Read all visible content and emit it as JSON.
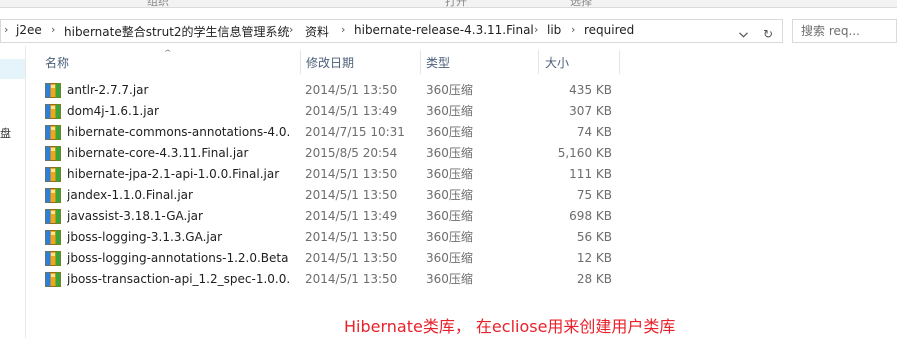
{
  "ribbon": {
    "groups": [
      "组织",
      "打开",
      "选择"
    ]
  },
  "address_bar": {
    "breadcrumbs": [
      "j2ee",
      "hibernate整合strut2的学生信息管理系统",
      "资料",
      "hibernate-release-4.3.11.Final",
      "lib",
      "required"
    ],
    "separator": "›",
    "refresh_glyph": "↻"
  },
  "search": {
    "placeholder": "搜索 req..."
  },
  "navigation_pane": {
    "partial_label": "盘"
  },
  "columns": {
    "name": "名称",
    "date_modified": "修改日期",
    "type": "类型",
    "size": "大小",
    "sort_indicator": "^"
  },
  "files": [
    {
      "name": "antlr-2.7.7.jar",
      "date": "2014/5/1 13:50",
      "type": "360压缩",
      "size": "435 KB"
    },
    {
      "name": "dom4j-1.6.1.jar",
      "date": "2014/5/1 13:49",
      "type": "360压缩",
      "size": "307 KB"
    },
    {
      "name": "hibernate-commons-annotations-4.0....",
      "date": "2014/7/15 10:31",
      "type": "360压缩",
      "size": "74 KB"
    },
    {
      "name": "hibernate-core-4.3.11.Final.jar",
      "date": "2015/8/5 20:54",
      "type": "360压缩",
      "size": "5,160 KB"
    },
    {
      "name": "hibernate-jpa-2.1-api-1.0.0.Final.jar",
      "date": "2014/5/1 13:50",
      "type": "360压缩",
      "size": "111 KB"
    },
    {
      "name": "jandex-1.1.0.Final.jar",
      "date": "2014/5/1 13:50",
      "type": "360压缩",
      "size": "75 KB"
    },
    {
      "name": "javassist-3.18.1-GA.jar",
      "date": "2014/5/1 13:49",
      "type": "360压缩",
      "size": "698 KB"
    },
    {
      "name": "jboss-logging-3.1.3.GA.jar",
      "date": "2014/5/1 13:50",
      "type": "360压缩",
      "size": "56 KB"
    },
    {
      "name": "jboss-logging-annotations-1.2.0.Beta...",
      "date": "2014/5/1 13:50",
      "type": "360压缩",
      "size": "12 KB"
    },
    {
      "name": "jboss-transaction-api_1.2_spec-1.0.0....",
      "date": "2014/5/1 13:50",
      "type": "360压缩",
      "size": "28 KB"
    }
  ],
  "annotation": {
    "text": "Hibernate类库， 在ecliose用来创建用户类库",
    "color": "#e8212a"
  },
  "file_icon": "360-archive-icon"
}
